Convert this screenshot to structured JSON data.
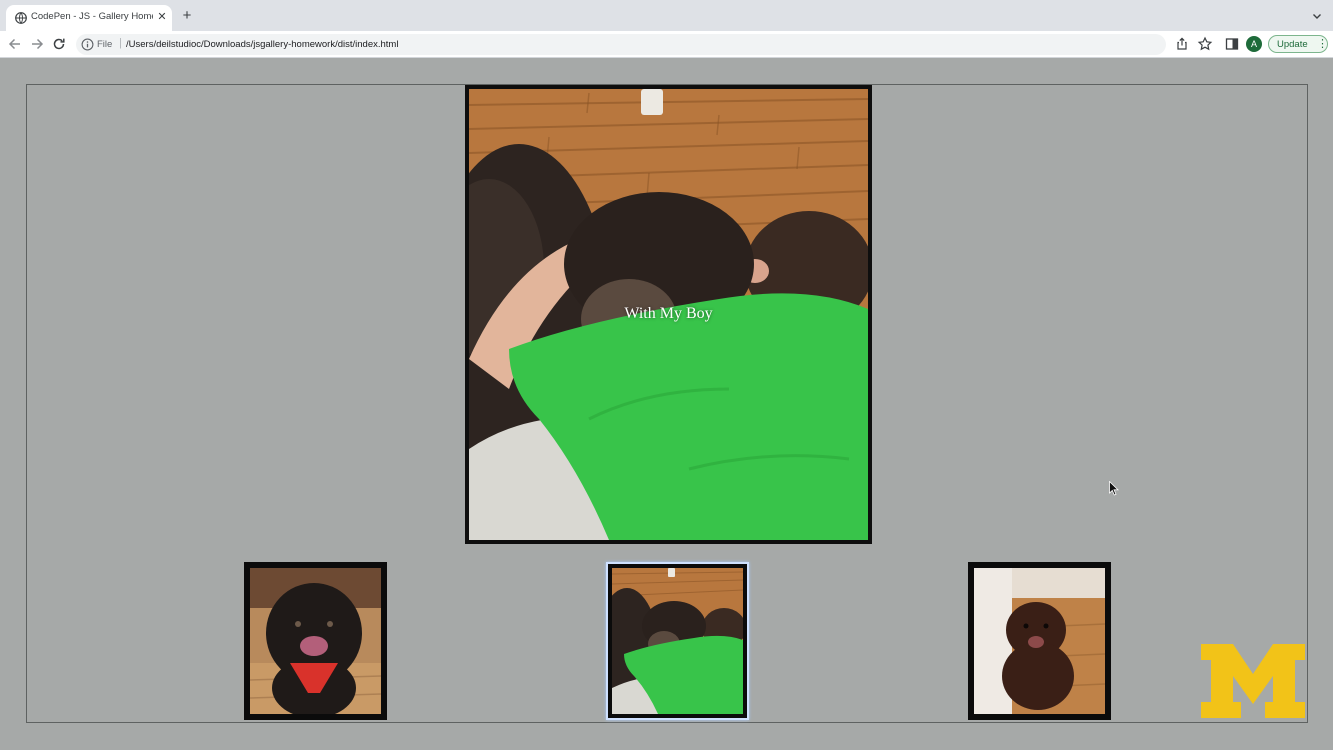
{
  "browser": {
    "tab_title": "CodePen - JS - Gallery Homew",
    "new_tab_icon": "plus-icon",
    "address_scheme": "File",
    "address_url": "/Users/deilstudioc/Downloads/jsgallery-homework/dist/index.html",
    "profile_initial": "A",
    "update_label": "Update",
    "update_menu": "⋮",
    "icons": [
      "back-icon",
      "forward-icon",
      "reload-icon",
      "info-icon",
      "share-icon",
      "star-icon",
      "side-panel-icon",
      "chevron-down-icon"
    ]
  },
  "gallery": {
    "main_caption": "With My Boy",
    "thumbnails": [
      {
        "subject": "dog-with-red-bandana",
        "selected": false
      },
      {
        "subject": "dog-with-boy",
        "selected": true
      },
      {
        "subject": "brown-puppy-sitting",
        "selected": false
      }
    ]
  },
  "logo": {
    "letter": "M",
    "color": "#f2c318"
  },
  "colors": {
    "background": "#a6a9a8",
    "frame": "#0e0e0e",
    "shirt_green": "#38c44a",
    "floor_wood": "#b8773e"
  }
}
